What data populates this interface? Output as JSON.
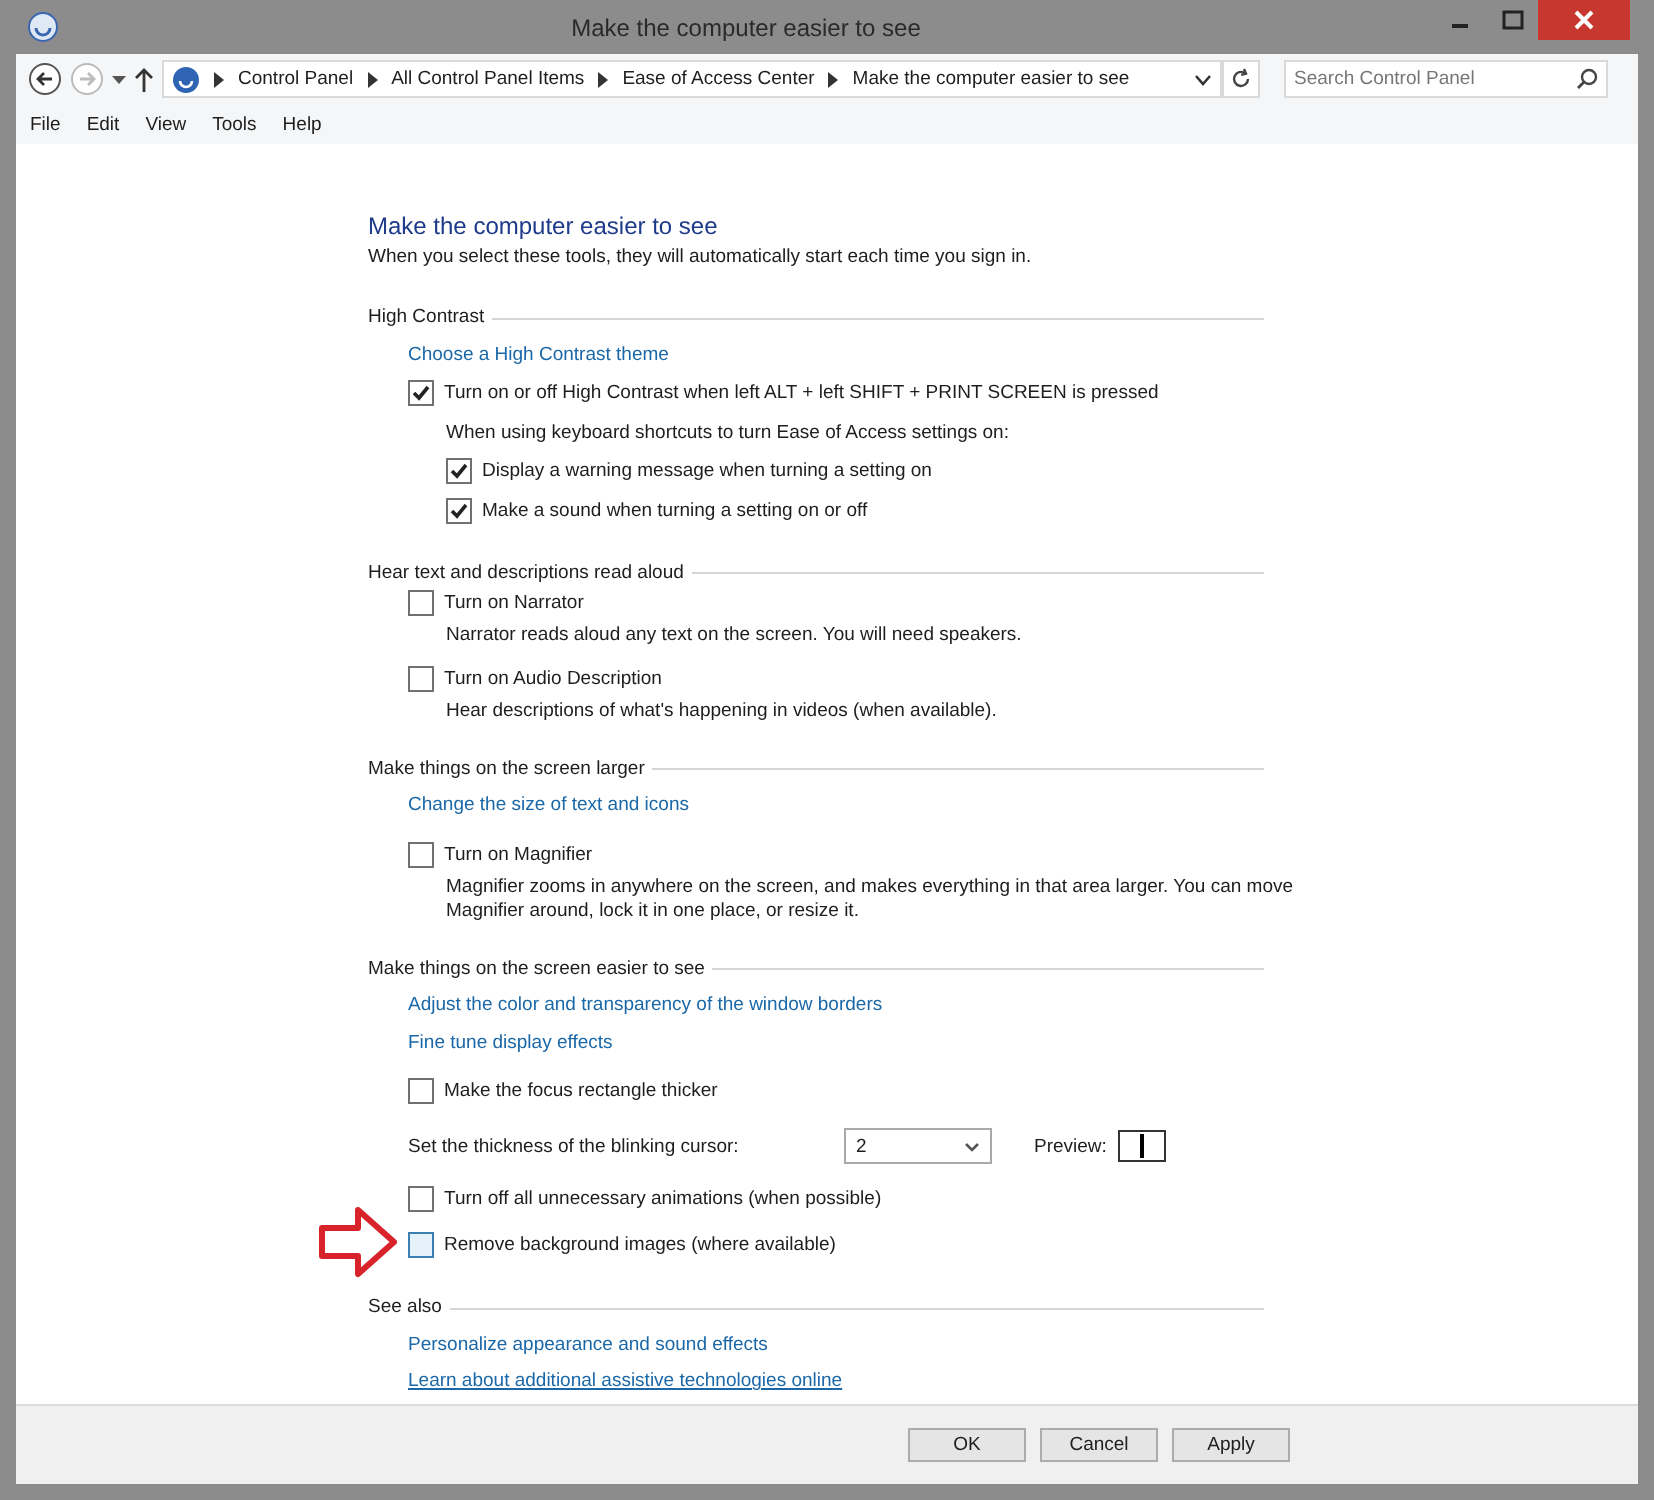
{
  "window": {
    "title": "Make the computer easier to see"
  },
  "address_bar": {
    "breadcrumbs": [
      "Control Panel",
      "All Control Panel Items",
      "Ease of Access Center",
      "Make the computer easier to see"
    ]
  },
  "search": {
    "placeholder": "Search Control Panel"
  },
  "menu": [
    "File",
    "Edit",
    "View",
    "Tools",
    "Help"
  ],
  "page": {
    "title": "Make the computer easier to see",
    "subtitle": "When you select these tools, they will automatically start each time you sign in."
  },
  "sections": [
    {
      "heading": "High Contrast",
      "items": [
        {
          "kind": "link",
          "text": "Choose a High Contrast theme",
          "hovered": false
        },
        {
          "kind": "checkbox",
          "text": "Turn on or off High Contrast when left ALT + left SHIFT + PRINT SCREEN is pressed",
          "checked": true,
          "hovered": false,
          "annotated": false
        },
        {
          "kind": "note",
          "text": "When using keyboard shortcuts to turn Ease of Access settings on:"
        },
        {
          "kind": "subcheckbox",
          "text": "Display a warning message when turning a setting on",
          "checked": true,
          "hovered": false,
          "annotated": false
        },
        {
          "kind": "subcheckbox",
          "text": "Make a sound when turning a setting on or off",
          "checked": true,
          "hovered": false,
          "annotated": false
        }
      ]
    },
    {
      "heading": "Hear text and descriptions read aloud",
      "items": [
        {
          "kind": "checkbox",
          "text": "Turn on Narrator",
          "checked": false,
          "hovered": false,
          "annotated": false
        },
        {
          "kind": "desc",
          "text": "Narrator reads aloud any text on the screen. You will need speakers."
        },
        {
          "kind": "checkbox",
          "text": "Turn on Audio Description",
          "checked": false,
          "hovered": false,
          "annotated": false
        },
        {
          "kind": "desc",
          "text": "Hear descriptions of what's happening in videos (when available)."
        }
      ]
    },
    {
      "heading": "Make things on the screen larger",
      "items": [
        {
          "kind": "link",
          "text": "Change the size of text and icons",
          "hovered": false
        },
        {
          "kind": "checkbox",
          "text": "Turn on Magnifier",
          "checked": false,
          "hovered": false,
          "annotated": false
        },
        {
          "kind": "desc",
          "text": "Magnifier zooms in anywhere on the screen, and makes everything in that area larger. You can move Magnifier around, lock it in one place, or resize it."
        }
      ]
    },
    {
      "heading": "Make things on the screen easier to see",
      "items": [
        {
          "kind": "link",
          "text": "Adjust the color and transparency of the window borders",
          "hovered": false
        },
        {
          "kind": "link",
          "text": "Fine tune display effects",
          "hovered": false
        },
        {
          "kind": "checkbox",
          "text": "Make the focus rectangle thicker",
          "checked": false,
          "hovered": false,
          "annotated": false
        },
        {
          "kind": "select",
          "label": "Set the thickness of the blinking cursor:",
          "value": "2",
          "preview_label": "Preview:"
        },
        {
          "kind": "checkbox",
          "text": "Turn off all unnecessary animations (when possible)",
          "checked": false,
          "hovered": false,
          "annotated": false
        },
        {
          "kind": "checkbox",
          "text": "Remove background images (where available)",
          "checked": false,
          "hovered": true,
          "annotated": true
        }
      ]
    },
    {
      "heading": "See also",
      "items": [
        {
          "kind": "link",
          "text": "Personalize appearance and sound effects",
          "hovered": false
        },
        {
          "kind": "link",
          "text": "Learn about additional assistive technologies online",
          "hovered": true
        }
      ]
    }
  ],
  "buttons": [
    "OK",
    "Cancel",
    "Apply"
  ]
}
